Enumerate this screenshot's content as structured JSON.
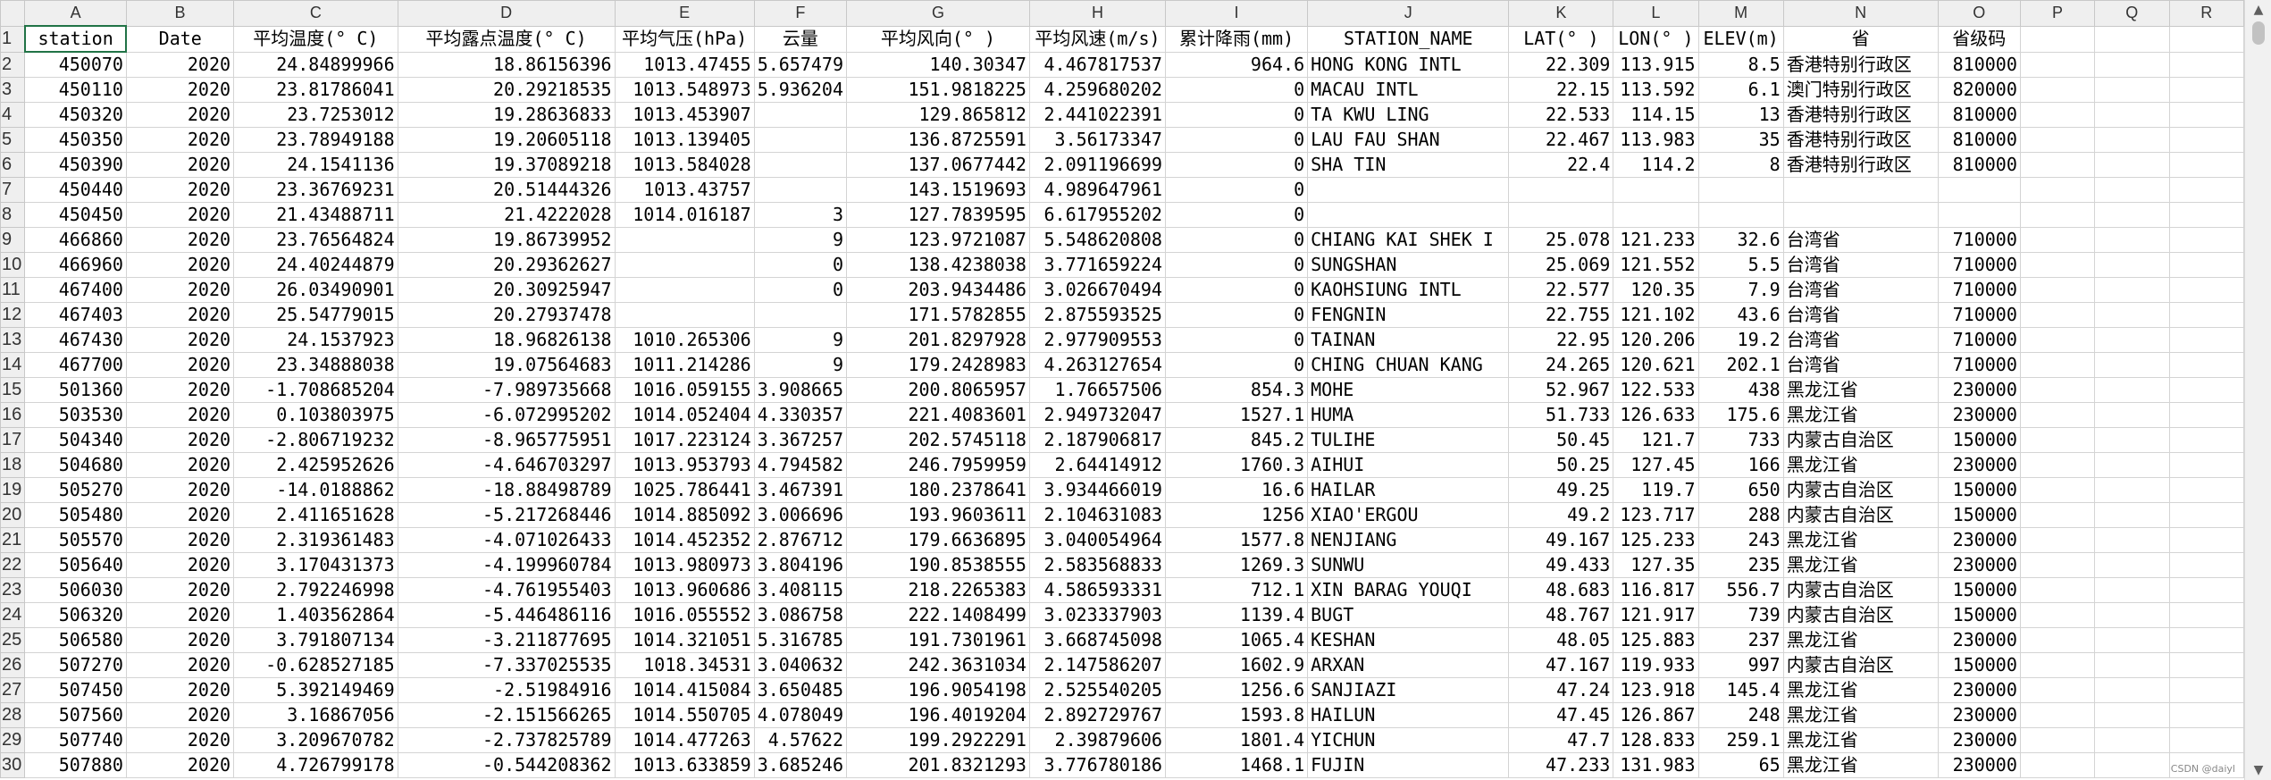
{
  "columns": [
    "A",
    "B",
    "C",
    "D",
    "E",
    "F",
    "G",
    "H",
    "I",
    "J",
    "K",
    "L",
    "M",
    "N",
    "O",
    "P",
    "Q",
    "R"
  ],
  "header_row": [
    "station",
    "Date",
    "平均温度(° C)",
    "平均露点温度(° C)",
    "平均气压(hPa)",
    "云量",
    "平均风向(° )",
    "平均风速(m/s)",
    "累计降雨(mm)",
    "STATION_NAME",
    "LAT(° )",
    "LON(° )",
    "ELEV(m)",
    "省",
    "省级码"
  ],
  "rows": [
    [
      "450070",
      "2020",
      "24.84899966",
      "18.86156396",
      "1013.47455",
      "5.657479",
      "140.30347",
      "4.467817537",
      "964.6",
      "HONG KONG INTL",
      "22.309",
      "113.915",
      "8.5",
      "香港特别行政区",
      "810000"
    ],
    [
      "450110",
      "2020",
      "23.81786041",
      "20.29218535",
      "1013.548973",
      "5.936204",
      "151.9818225",
      "4.259680202",
      "0",
      "MACAU INTL",
      "22.15",
      "113.592",
      "6.1",
      "澳门特别行政区",
      "820000"
    ],
    [
      "450320",
      "2020",
      "23.7253012",
      "19.28636833",
      "1013.453907",
      "",
      "129.865812",
      "2.441022391",
      "0",
      "TA KWU LING",
      "22.533",
      "114.15",
      "13",
      "香港特别行政区",
      "810000"
    ],
    [
      "450350",
      "2020",
      "23.78949188",
      "19.20605118",
      "1013.139405",
      "",
      "136.8725591",
      "3.56173347",
      "0",
      "LAU FAU SHAN",
      "22.467",
      "113.983",
      "35",
      "香港特别行政区",
      "810000"
    ],
    [
      "450390",
      "2020",
      "24.1541136",
      "19.37089218",
      "1013.584028",
      "",
      "137.0677442",
      "2.091196699",
      "0",
      "SHA TIN",
      "22.4",
      "114.2",
      "8",
      "香港特别行政区",
      "810000"
    ],
    [
      "450440",
      "2020",
      "23.36769231",
      "20.51444326",
      "1013.43757",
      "",
      "143.1519693",
      "4.989647961",
      "0",
      "",
      "",
      "",
      "",
      "",
      ""
    ],
    [
      "450450",
      "2020",
      "21.43488711",
      "21.4222028",
      "1014.016187",
      "3",
      "127.7839595",
      "6.617955202",
      "0",
      "",
      "",
      "",
      "",
      "",
      ""
    ],
    [
      "466860",
      "2020",
      "23.76564824",
      "19.86739952",
      "",
      "9",
      "123.9721087",
      "5.548620808",
      "0",
      "CHIANG KAI SHEK I",
      "25.078",
      "121.233",
      "32.6",
      "台湾省",
      "710000"
    ],
    [
      "466960",
      "2020",
      "24.40244879",
      "20.29362627",
      "",
      "0",
      "138.4238038",
      "3.771659224",
      "0",
      "SUNGSHAN",
      "25.069",
      "121.552",
      "5.5",
      "台湾省",
      "710000"
    ],
    [
      "467400",
      "2020",
      "26.03490901",
      "20.30925947",
      "",
      "0",
      "203.9434486",
      "3.026670494",
      "0",
      "KAOHSIUNG INTL",
      "22.577",
      "120.35",
      "7.9",
      "台湾省",
      "710000"
    ],
    [
      "467403",
      "2020",
      "25.54779015",
      "20.27937478",
      "",
      "",
      "171.5782855",
      "2.875593525",
      "0",
      "FENGNIN",
      "22.755",
      "121.102",
      "43.6",
      "台湾省",
      "710000"
    ],
    [
      "467430",
      "2020",
      "24.1537923",
      "18.96826138",
      "1010.265306",
      "9",
      "201.8297928",
      "2.977909553",
      "0",
      "TAINAN",
      "22.95",
      "120.206",
      "19.2",
      "台湾省",
      "710000"
    ],
    [
      "467700",
      "2020",
      "23.34888038",
      "19.07564683",
      "1011.214286",
      "9",
      "179.2428983",
      "4.263127654",
      "0",
      "CHING CHUAN KANG",
      "24.265",
      "120.621",
      "202.1",
      "台湾省",
      "710000"
    ],
    [
      "501360",
      "2020",
      "-1.708685204",
      "-7.989735668",
      "1016.059155",
      "3.908665",
      "200.8065957",
      "1.76657506",
      "854.3",
      "MOHE",
      "52.967",
      "122.533",
      "438",
      "黑龙江省",
      "230000"
    ],
    [
      "503530",
      "2020",
      "0.103803975",
      "-6.072995202",
      "1014.052404",
      "4.330357",
      "221.4083601",
      "2.949732047",
      "1527.1",
      "HUMA",
      "51.733",
      "126.633",
      "175.6",
      "黑龙江省",
      "230000"
    ],
    [
      "504340",
      "2020",
      "-2.806719232",
      "-8.965775951",
      "1017.223124",
      "3.367257",
      "202.5745118",
      "2.187906817",
      "845.2",
      "TULIHE",
      "50.45",
      "121.7",
      "733",
      "内蒙古自治区",
      "150000"
    ],
    [
      "504680",
      "2020",
      "2.425952626",
      "-4.646703297",
      "1013.953793",
      "4.794582",
      "246.7959959",
      "2.64414912",
      "1760.3",
      "AIHUI",
      "50.25",
      "127.45",
      "166",
      "黑龙江省",
      "230000"
    ],
    [
      "505270",
      "2020",
      "-14.0188862",
      "-18.88498789",
      "1025.786441",
      "3.467391",
      "180.2378641",
      "3.934466019",
      "16.6",
      "HAILAR",
      "49.25",
      "119.7",
      "650",
      "内蒙古自治区",
      "150000"
    ],
    [
      "505480",
      "2020",
      "2.411651628",
      "-5.217268446",
      "1014.885092",
      "3.006696",
      "193.9603611",
      "2.104631083",
      "1256",
      "XIAO'ERGOU",
      "49.2",
      "123.717",
      "288",
      "内蒙古自治区",
      "150000"
    ],
    [
      "505570",
      "2020",
      "2.319361483",
      "-4.071026433",
      "1014.452352",
      "2.876712",
      "179.6636895",
      "3.040054964",
      "1577.8",
      "NENJIANG",
      "49.167",
      "125.233",
      "243",
      "黑龙江省",
      "230000"
    ],
    [
      "505640",
      "2020",
      "3.170431373",
      "-4.199960784",
      "1013.980973",
      "3.804196",
      "190.8538555",
      "2.583568833",
      "1269.3",
      "SUNWU",
      "49.433",
      "127.35",
      "235",
      "黑龙江省",
      "230000"
    ],
    [
      "506030",
      "2020",
      "2.792246998",
      "-4.761955403",
      "1013.960686",
      "3.408115",
      "218.2265383",
      "4.586593331",
      "712.1",
      "XIN BARAG YOUQI",
      "48.683",
      "116.817",
      "556.7",
      "内蒙古自治区",
      "150000"
    ],
    [
      "506320",
      "2020",
      "1.403562864",
      "-5.446486116",
      "1016.055552",
      "3.086758",
      "222.1408499",
      "3.023337903",
      "1139.4",
      "BUGT",
      "48.767",
      "121.917",
      "739",
      "内蒙古自治区",
      "150000"
    ],
    [
      "506580",
      "2020",
      "3.791807134",
      "-3.211877695",
      "1014.321051",
      "5.316785",
      "191.7301961",
      "3.668745098",
      "1065.4",
      "KESHAN",
      "48.05",
      "125.883",
      "237",
      "黑龙江省",
      "230000"
    ],
    [
      "507270",
      "2020",
      "-0.628527185",
      "-7.337025535",
      "1018.34531",
      "3.040632",
      "242.3631034",
      "2.147586207",
      "1602.9",
      "ARXAN",
      "47.167",
      "119.933",
      "997",
      "内蒙古自治区",
      "150000"
    ],
    [
      "507450",
      "2020",
      "5.392149469",
      "-2.51984916",
      "1014.415084",
      "3.650485",
      "196.9054198",
      "2.525540205",
      "1256.6",
      "SANJIAZI",
      "47.24",
      "123.918",
      "145.4",
      "黑龙江省",
      "230000"
    ],
    [
      "507560",
      "2020",
      "3.16867056",
      "-2.151566265",
      "1014.550705",
      "4.078049",
      "196.4019204",
      "2.892729767",
      "1593.8",
      "HAILUN",
      "47.45",
      "126.867",
      "248",
      "黑龙江省",
      "230000"
    ],
    [
      "507740",
      "2020",
      "3.209670782",
      "-2.737825789",
      "1014.477263",
      "4.57622",
      "199.2922291",
      "2.39879606",
      "1801.4",
      "YICHUN",
      "47.7",
      "128.833",
      "259.1",
      "黑龙江省",
      "230000"
    ],
    [
      "507880",
      "2020",
      "4.726799178",
      "-0.544208362",
      "1013.633859",
      "3.685246",
      "201.8321293",
      "3.776780186",
      "1468.1",
      "FUJIN",
      "47.233",
      "131.983",
      "65",
      "黑龙江省",
      "230000"
    ]
  ],
  "watermark": "CSDN @daiyl"
}
